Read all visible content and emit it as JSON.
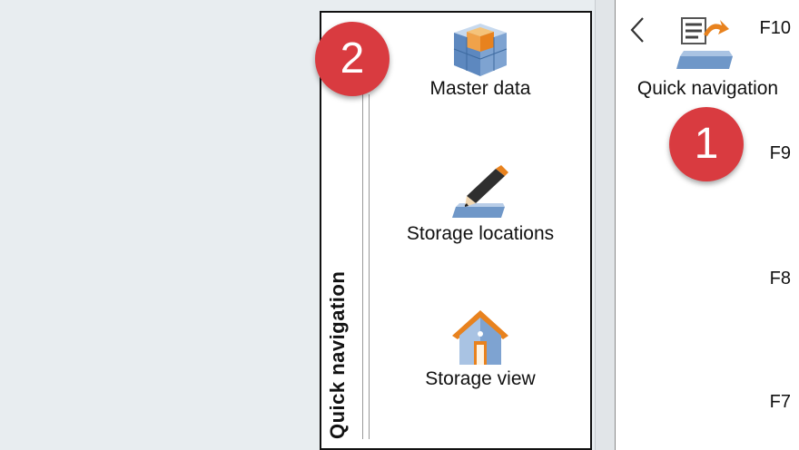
{
  "panel": {
    "title": "Quick navigation",
    "items": [
      {
        "label": "Master data",
        "icon": "cube-blocks-icon"
      },
      {
        "label": "Storage locations",
        "icon": "pencil-edit-icon"
      },
      {
        "label": "Storage view",
        "icon": "house-icon"
      }
    ]
  },
  "fkeys": [
    {
      "code": "F10",
      "label": "Quick navigation"
    },
    {
      "code": "F9",
      "label": ""
    },
    {
      "code": "F8",
      "label": ""
    },
    {
      "code": "F7",
      "label": ""
    }
  ],
  "badges": [
    "1",
    "2"
  ],
  "colors": {
    "badge": "#d93b40",
    "accent_orange": "#e8821e",
    "accent_blue": "#4a7fc0"
  }
}
